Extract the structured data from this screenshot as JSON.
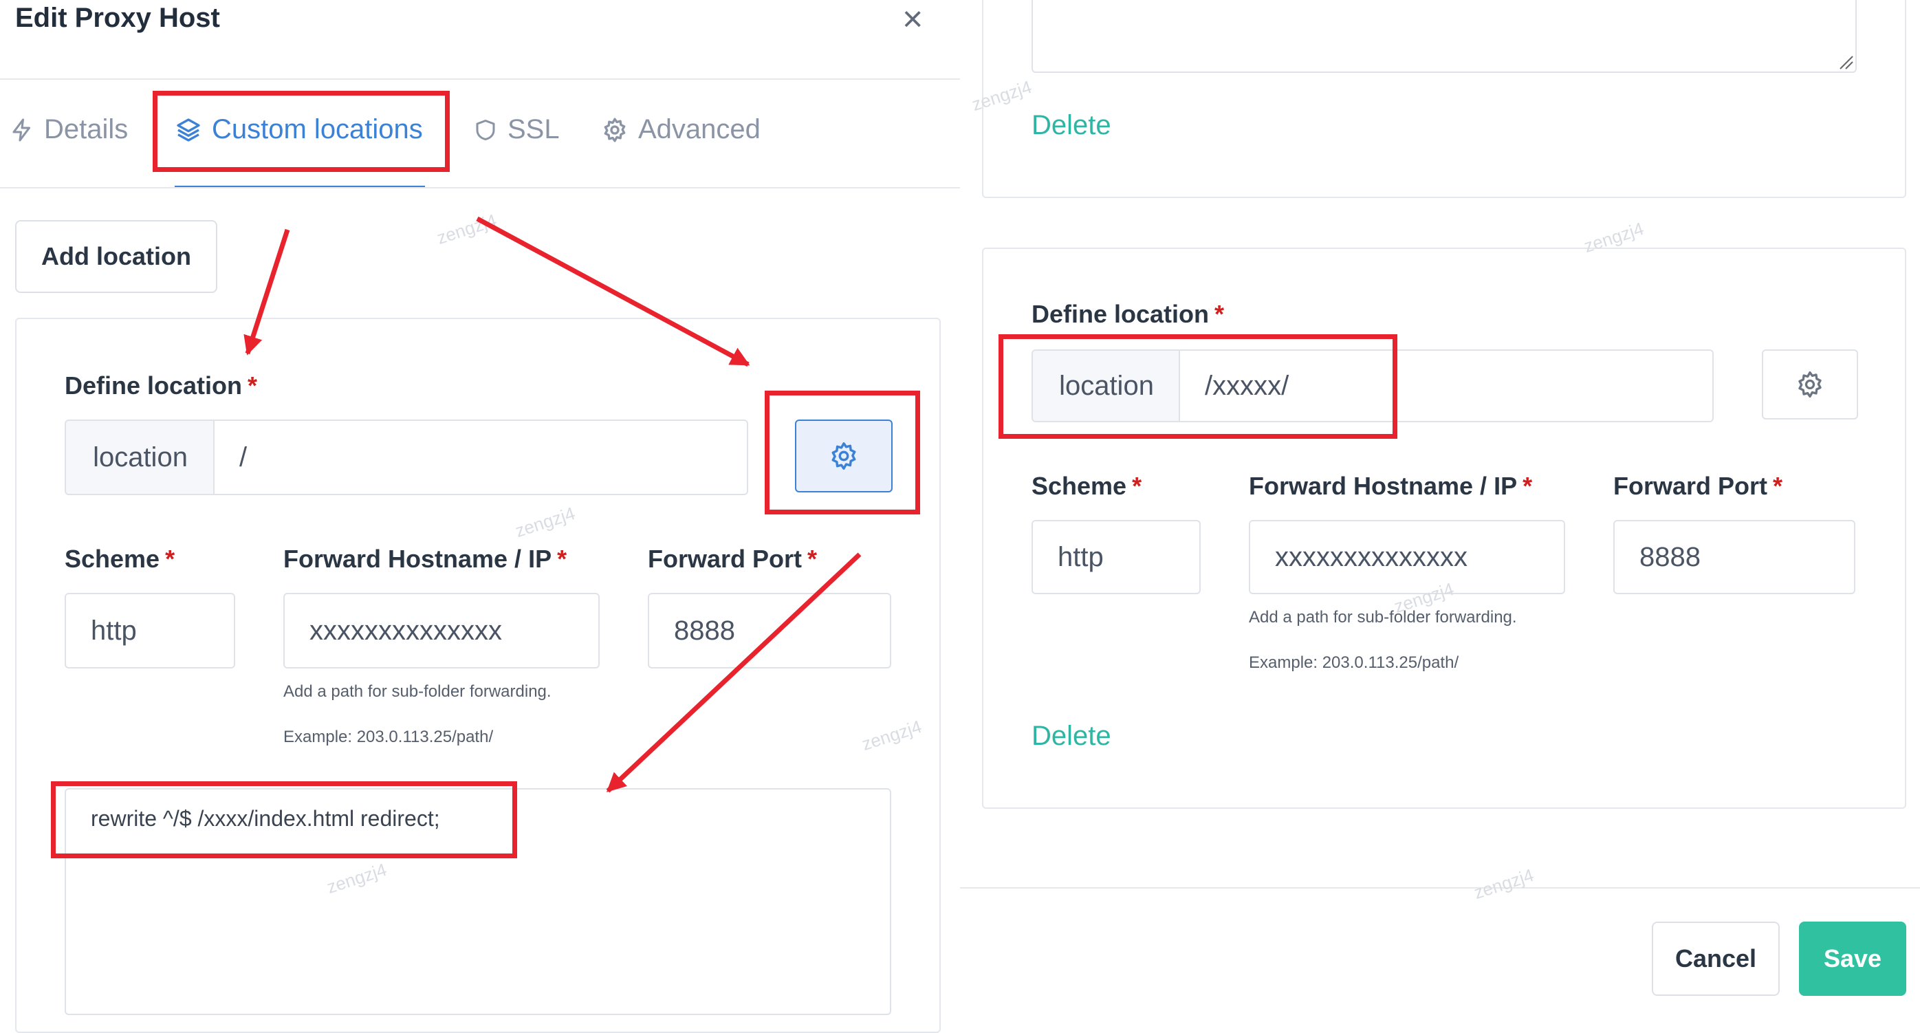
{
  "dialog": {
    "title": "Edit Proxy Host",
    "close_glyph": "×"
  },
  "tabs": [
    {
      "label": "Details",
      "icon": "bolt-icon"
    },
    {
      "label": "Custom locations",
      "icon": "layers-icon",
      "active": true
    },
    {
      "label": "SSL",
      "icon": "shield-icon"
    },
    {
      "label": "Advanced",
      "icon": "gear-icon"
    }
  ],
  "add_location_label": "Add location",
  "location_left": {
    "define_label": "Define location",
    "required_mark": "*",
    "prefix": "location",
    "path": "/",
    "scheme_label": "Scheme",
    "scheme_value": "http",
    "host_label": "Forward Hostname / IP",
    "host_value": "xxxxxxxxxxxxxx",
    "port_label": "Forward Port",
    "port_value": "8888",
    "hint1": "Add a path for sub-folder forwarding.",
    "hint2": "Example: 203.0.113.25/path/",
    "advanced_config": "rewrite ^/$ /xxxx/index.html redirect;"
  },
  "location_top_right": {
    "delete_label": "Delete"
  },
  "location_right": {
    "define_label": "Define location",
    "required_mark": "*",
    "prefix": "location",
    "path": "/xxxxx/",
    "scheme_label": "Scheme",
    "scheme_value": "http",
    "host_label": "Forward Hostname / IP",
    "host_value": "xxxxxxxxxxxxxx",
    "port_label": "Forward Port",
    "port_value": "8888",
    "hint1": "Add a path for sub-folder forwarding.",
    "hint2": "Example: 203.0.113.25/path/",
    "delete_label": "Delete"
  },
  "footer": {
    "cancel_label": "Cancel",
    "save_label": "Save"
  },
  "watermark": "zengzj4",
  "colors": {
    "accent": "#3b82d6",
    "highlight": "#e8232d",
    "save": "#2fc1a0",
    "link": "#2fb5a4",
    "required": "#cd201f"
  }
}
